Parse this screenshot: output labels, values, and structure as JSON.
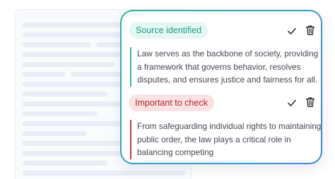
{
  "cards": [
    {
      "badge": "Source identified",
      "lines": [
        "Law serves as the backbone of society, providing",
        "a framework that governs behavior, resolves",
        "disputes, and ensures justice and fairness for all."
      ],
      "accent": "#2cb89a"
    },
    {
      "badge": "Important to check",
      "lines": [
        "From safeguarding individual rights to maintaining",
        "public order, the law plays a critical role in",
        "balancing competing"
      ],
      "accent": "#c43a40"
    }
  ],
  "icons": {
    "accept": "check-icon",
    "delete": "trash-icon"
  },
  "colors": {
    "border_gradient_start": "#2cb89a",
    "border_gradient_end": "#3f86e6",
    "teal_badge_bg": "#e5f7f3",
    "teal_badge_text": "#1e9f86",
    "red_badge_bg": "#fbe3e4",
    "red_badge_text": "#b1262e"
  }
}
